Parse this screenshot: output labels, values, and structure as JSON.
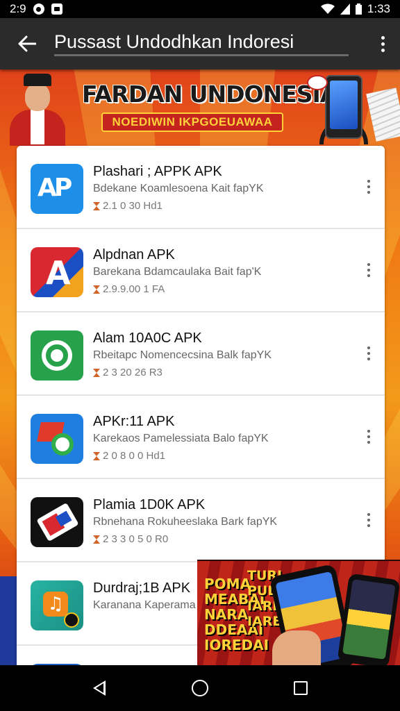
{
  "status_bar": {
    "time_left": "2:9",
    "time_right": "1:33"
  },
  "app_bar": {
    "title": "Pussast Undodhkan Indoresi"
  },
  "banner": {
    "title": "FARDAN UNDONESIA",
    "subtitle": "NOEDIWIN IKPGOEUAWAA"
  },
  "apps": [
    {
      "name": "Plashari ; APPK APK",
      "desc": "Bdekane Koamlesoena Kait fapYK",
      "meta": "2.1 0 30 Hd1",
      "icon": "app-a-blue-icon",
      "icon_class": "ic-blue",
      "glyph": "AP"
    },
    {
      "name": "Alpdnan APK",
      "desc": "Barekana Bdamcaulaka Bait fap'K",
      "meta": "2.9.9.00 1 FA",
      "icon": "app-a-triangle-icon",
      "icon_class": "ic-adp",
      "glyph": "A"
    },
    {
      "name": "Alam 10A0C APK",
      "desc": "Rbeitapc Nomencecsina Balk fapYK",
      "meta": "2 3 20 26 R3",
      "icon": "app-green-ring-icon",
      "icon_class": "ic-green",
      "glyph": ""
    },
    {
      "name": "APKr:11 APK",
      "desc": "Karekaos Pamelessiata Balo fapYK",
      "meta": "2 0 8 0 0 Hd1",
      "icon": "app-flag-g-icon",
      "icon_class": "ic-apkr",
      "glyph": ""
    },
    {
      "name": "Plamia 1D0K APK",
      "desc": "Rbnehana Rokuheeslaka Bark fapYK",
      "meta": "2 3 3 0 5 0 R0",
      "icon": "app-card-icon",
      "icon_class": "ic-black",
      "glyph": ""
    },
    {
      "name": "Durdraj;1B APK",
      "desc": "Karanana Kaperama",
      "meta": "",
      "icon": "app-music-icon",
      "icon_class": "ic-music",
      "glyph": "♫"
    },
    {
      "name": "",
      "desc": "",
      "meta": "",
      "icon": "app-partial-icon",
      "icon_class": "ic-partial",
      "glyph": ""
    }
  ],
  "ad": {
    "text_left": "POMA\nMEABAI\nNARA\nDDEAAI\nIOREDAI",
    "text_mid": "TURI\nPUDI\nIAREDA\nIAREDI"
  },
  "colors": {
    "app_bar": "#2b2b2b",
    "banner_accent": "#c4231e",
    "background_orange": "#f07a14"
  }
}
